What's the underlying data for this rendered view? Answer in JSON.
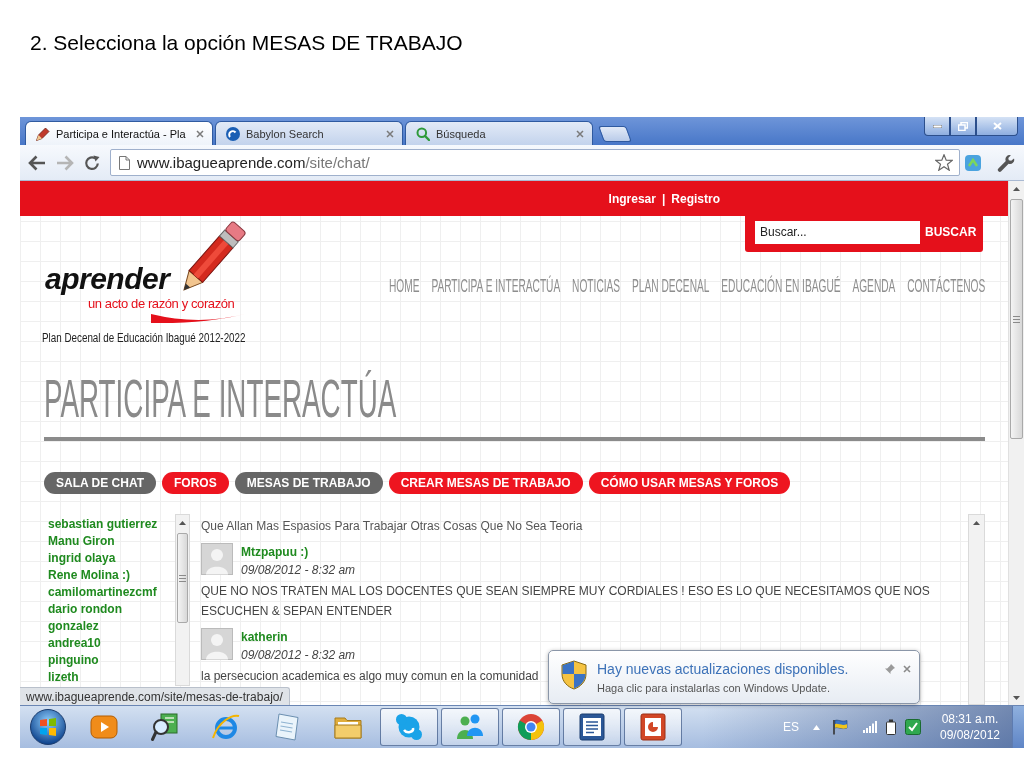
{
  "slide": {
    "title": "2. Selecciona la opción MESAS DE TRABAJO"
  },
  "browser": {
    "tabs": [
      {
        "kind": "pencil",
        "title": "Participa e Interactúa - Pla",
        "selected": true
      },
      {
        "kind": "swirl",
        "title": "Babylon Search",
        "selected": false
      },
      {
        "kind": "search",
        "title": "Búsqueda",
        "selected": false
      }
    ],
    "forward_disabled": true,
    "address": {
      "domain": "www.ibagueaprende.com",
      "path": "/site/chat/"
    },
    "status_url": "www.ibagueaprende.com/site/mesas-de-trabajo/"
  },
  "site": {
    "top_bar": {
      "links": [
        "Ingresar",
        "Registro"
      ],
      "separator": "|"
    },
    "search": {
      "placeholder": "Buscar...",
      "button": "BUSCAR"
    },
    "logo": {
      "wordmark": "aprender",
      "slogan": "un acto de razón y corazón",
      "tagline": "Plan Decenal de Educación Ibagué 2012-2022"
    },
    "nav": [
      "HOME",
      "PARTICIPA E INTERACTÚA",
      "NOTICIAS",
      "PLAN DECENAL",
      "EDUCACIÓN EN IBAGUÉ",
      "AGENDA",
      "CONTÁCTENOS"
    ],
    "page_title": "PARTICIPA E INTERACTÚA",
    "section_buttons": [
      {
        "label": "SALA DE CHAT",
        "highlighted": true
      },
      {
        "label": "FOROS",
        "highlighted": false
      },
      {
        "label": "MESAS DE TRABAJO",
        "highlighted": true
      },
      {
        "label": "CREAR MESAS DE TRABAJO",
        "highlighted": false
      },
      {
        "label": "CÓMO USAR MESAS Y FOROS",
        "highlighted": false
      }
    ],
    "chat": {
      "users": [
        "sebastian gutierrez",
        "Manu Giron",
        "ingrid olaya",
        "Rene Molina :)",
        "camilomartinezcmf",
        "dario rondon",
        "gonzalez",
        "andrea10",
        "pinguino",
        "lizeth"
      ],
      "messages": [
        {
          "kind": "continued",
          "text": "Que Allan Mas Espasios Para Trabajar Otras Cosas Que No Sea Teoria"
        },
        {
          "kind": "post",
          "author": "Mtzpapuu :)",
          "time": "09/08/2012 - 8:32 am",
          "text": "QUE NO NOS TRATEN MAL LOS DOCENTES QUE SEAN SIEMPRE MUY CORDIALES ! ESO ES LO QUE NECESITAMOS QUE NOS ESCUCHEN & SEPAN ENTENDER"
        },
        {
          "kind": "post",
          "author": "katherin",
          "time": "09/08/2012 - 8:32 am",
          "text": "la persecucion academica es algo muy comun en la comunidad"
        }
      ]
    }
  },
  "notification": {
    "title": "Hay nuevas actualizaciones disponibles.",
    "text": "Haga clic para instalarlas con Windows Update."
  },
  "taskbar": {
    "apps": [
      {
        "kind": "play",
        "running": false
      },
      {
        "kind": "magnifier",
        "running": false
      },
      {
        "kind": "ring",
        "running": false
      },
      {
        "kind": "notepad",
        "running": false
      },
      {
        "kind": "folder",
        "running": false
      },
      {
        "kind": "bubble",
        "running": true
      },
      {
        "kind": "people",
        "running": true
      },
      {
        "kind": "wheel",
        "running": true
      },
      {
        "kind": "document",
        "running": true
      },
      {
        "kind": "slides",
        "running": true
      }
    ],
    "language": "ES",
    "time": "08:31 a.m.",
    "date": "09/08/2012"
  }
}
